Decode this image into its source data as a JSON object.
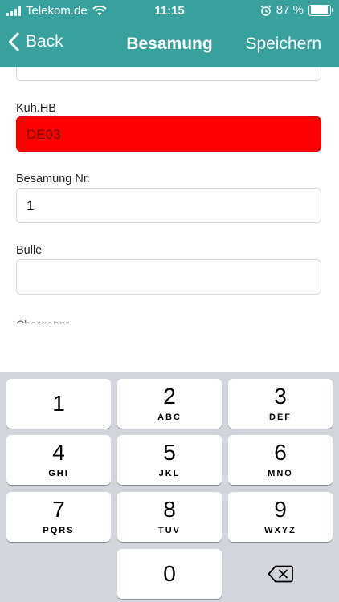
{
  "status_bar": {
    "carrier": "Telekom.de",
    "time": "11:15",
    "battery": "87 %"
  },
  "nav": {
    "back_label": "Back",
    "title": "Besamung",
    "save_label": "Speichern"
  },
  "form": {
    "fields": [
      {
        "label": "Kuh.HB",
        "value": "DE03",
        "highlight_color": "#ff0000"
      },
      {
        "label": "Besamung Nr.",
        "value": "1"
      },
      {
        "label": "Bulle",
        "value": ""
      }
    ],
    "next_label_partial": "Chargennr."
  },
  "keyboard": {
    "keys": [
      {
        "num": "1",
        "letters": ""
      },
      {
        "num": "2",
        "letters": "ABC"
      },
      {
        "num": "3",
        "letters": "DEF"
      },
      {
        "num": "4",
        "letters": "GHI"
      },
      {
        "num": "5",
        "letters": "JKL"
      },
      {
        "num": "6",
        "letters": "MNO"
      },
      {
        "num": "7",
        "letters": "PQRS"
      },
      {
        "num": "8",
        "letters": "TUV"
      },
      {
        "num": "9",
        "letters": "WXYZ"
      },
      {
        "num": "0",
        "letters": ""
      }
    ]
  },
  "colors": {
    "header": "#38a09d",
    "keyboard_bg": "#d2d5db",
    "error_field": "#ff0000"
  }
}
